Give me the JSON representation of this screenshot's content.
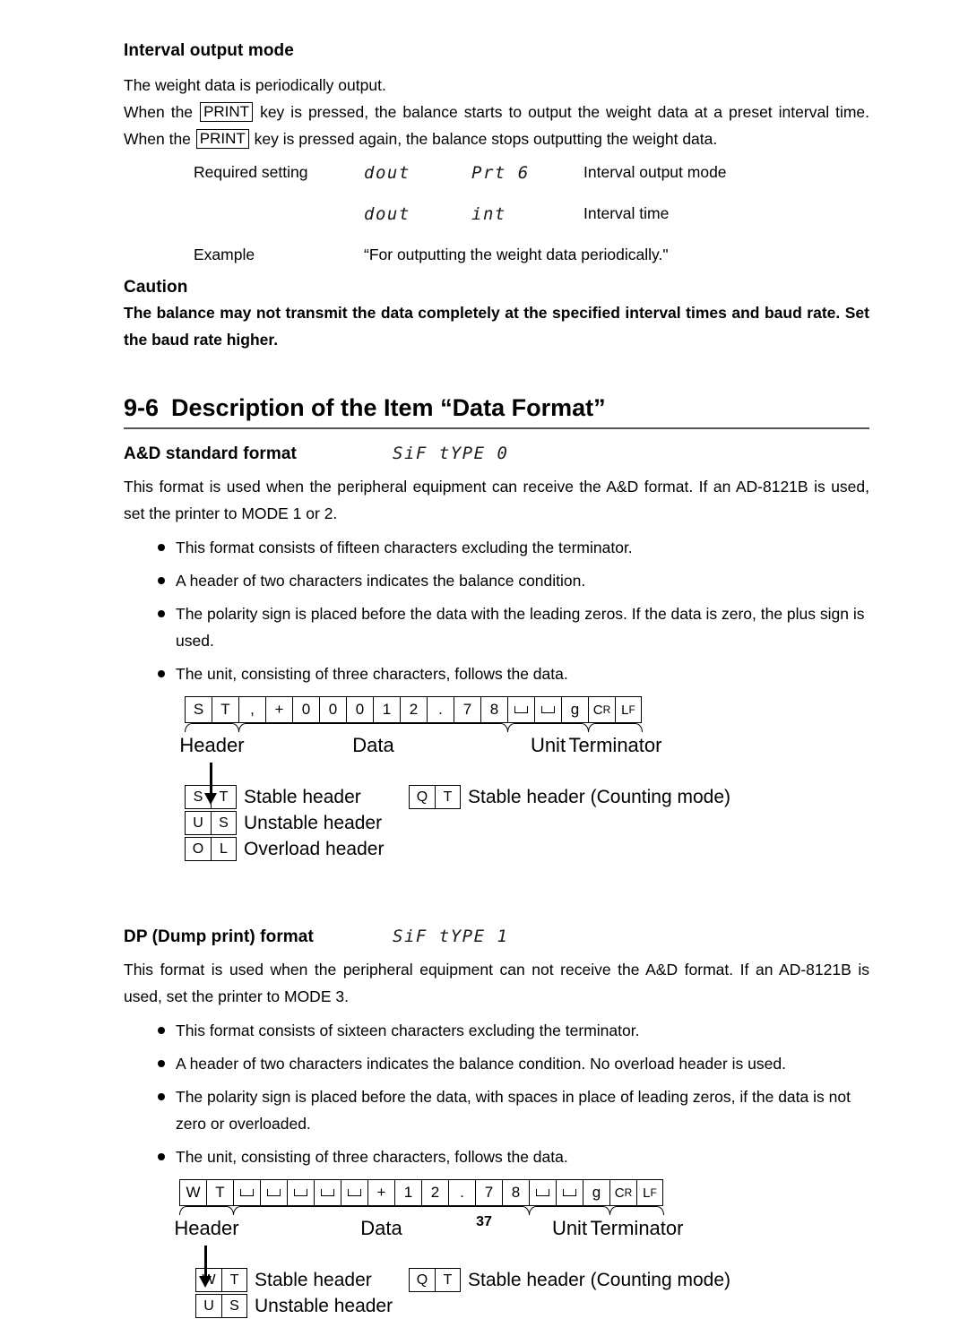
{
  "interval": {
    "heading": "Interval output mode",
    "line1": "The weight data is periodically output.",
    "line2_a": "When the",
    "key": "PRINT",
    "line2_b": "key is pressed, the balance starts to output the weight data at a preset interval time. When the",
    "line2_c": "key is pressed again, the balance stops outputting the weight data.",
    "rows": [
      {
        "label": "Required setting",
        "lcd1": "dout",
        "lcd2": "Prt 6",
        "desc": "Interval output mode"
      },
      {
        "label": "",
        "lcd1": "dout",
        "lcd2": "int",
        "desc": "Interval time"
      }
    ],
    "example_label": "Example",
    "example_text": "“For outputting the weight data periodically.\""
  },
  "caution": {
    "heading": "Caution",
    "text": "The balance may not transmit the data completely at the specified interval times and baud rate. Set the baud rate higher."
  },
  "section": {
    "number": "9-6",
    "title": "Description of the Item “Data Format”"
  },
  "ad_format": {
    "title": "A&D standard format",
    "lcd": "SiF tYPE 0",
    "intro": "This format is used when the peripheral equipment can receive the A&D format. If an AD-8121B is used, set the printer to MODE 1 or 2.",
    "bullets": [
      "This format consists of fifteen characters excluding the terminator.",
      "A header of two characters indicates the balance condition.",
      "The polarity sign is placed before the data with the leading zeros. If the data is zero, the plus sign is used.",
      "The unit, consisting of three characters, follows the data."
    ],
    "cells": [
      "S",
      "T",
      ",",
      "+",
      "0",
      "0",
      "0",
      "1",
      "2",
      ".",
      "7",
      "8",
      "␣",
      "␣",
      "g",
      "CR",
      "LF"
    ],
    "group_labels": [
      "Header",
      "Data",
      "Unit",
      "Terminator"
    ],
    "legend_left": [
      {
        "c1": "S",
        "c2": "T",
        "text": "Stable header"
      },
      {
        "c1": "U",
        "c2": "S",
        "text": "Unstable header"
      },
      {
        "c1": "O",
        "c2": "L",
        "text": "Overload header"
      }
    ],
    "legend_right": {
      "c1": "Q",
      "c2": "T",
      "text": "Stable header (Counting mode)"
    }
  },
  "dp_format": {
    "title": "DP (Dump print) format",
    "lcd": "SiF tYPE 1",
    "intro": "This format is used when the peripheral equipment can not receive the A&D format. If an AD-8121B is used, set the printer to MODE 3.",
    "bullets": [
      "This format consists of sixteen characters excluding the terminator.",
      "A header of two characters indicates the balance condition. No overload header is used.",
      "The polarity sign is placed before the data, with spaces in place of leading zeros, if the data is not zero or overloaded.",
      "The unit, consisting of three characters, follows the data."
    ],
    "cells": [
      "W",
      "T",
      "␣",
      "␣",
      "␣",
      "␣",
      "␣",
      "+",
      "1",
      "2",
      ".",
      "7",
      "8",
      "␣",
      "␣",
      "g",
      "CR",
      "LF"
    ],
    "group_labels": [
      "Header",
      "Data",
      "Unit",
      "Terminator"
    ],
    "legend_left": [
      {
        "c1": "W",
        "c2": "T",
        "text": "Stable header"
      },
      {
        "c1": "U",
        "c2": "S",
        "text": "Unstable header"
      }
    ],
    "legend_right": {
      "c1": "Q",
      "c2": "T",
      "text": "Stable header (Counting mode)"
    }
  },
  "folio": "37"
}
